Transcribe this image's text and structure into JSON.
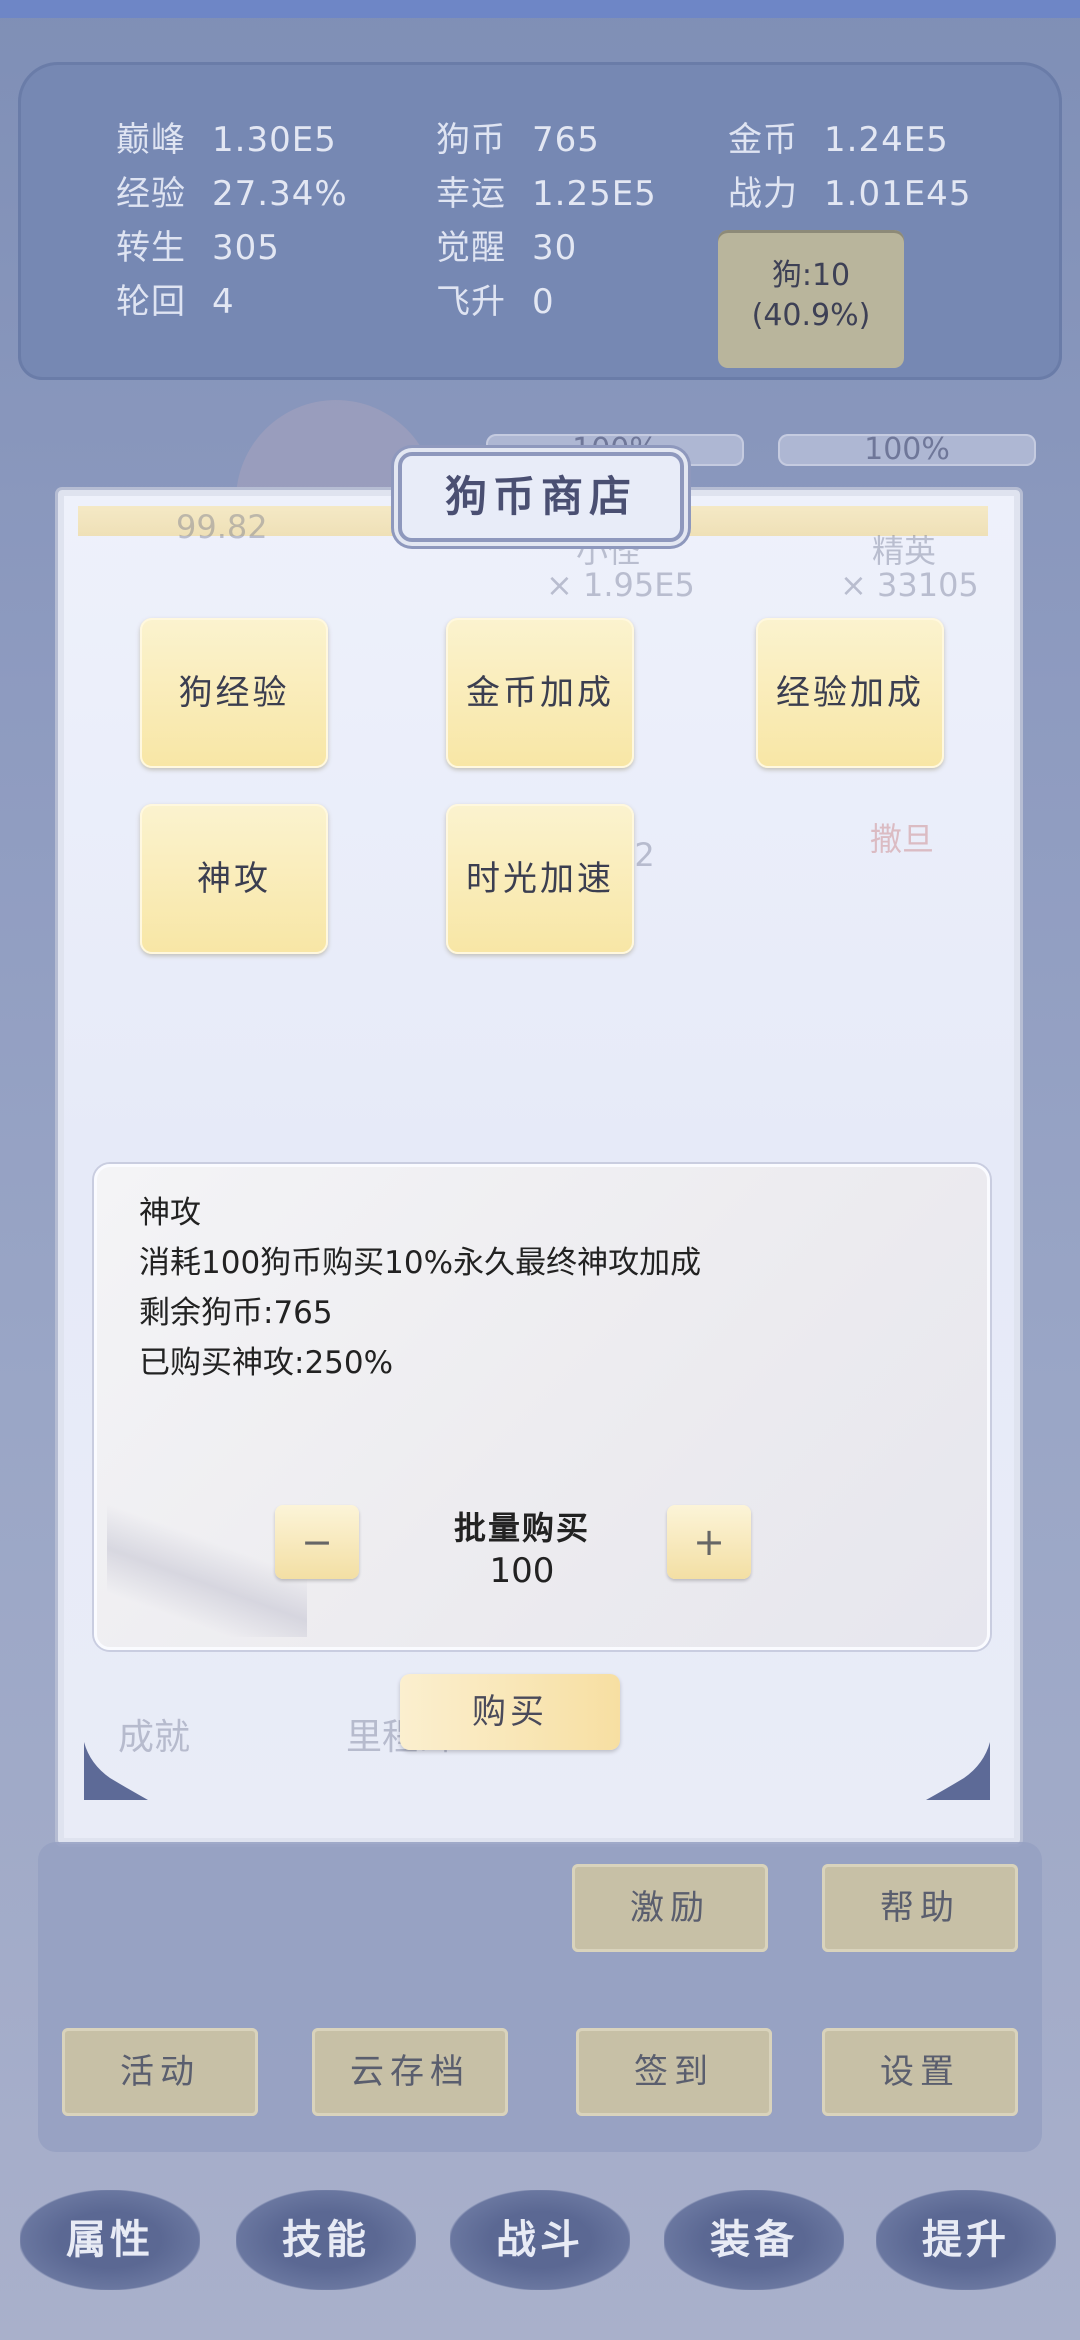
{
  "stats": {
    "peak": {
      "label": "巅峰",
      "value": "1.30E5"
    },
    "dog_coin": {
      "label": "狗币",
      "value": "765"
    },
    "gold": {
      "label": "金币",
      "value": "1.24E5"
    },
    "exp": {
      "label": "经验",
      "value": "27.34%"
    },
    "luck": {
      "label": "幸运",
      "value": "1.25E5"
    },
    "power": {
      "label": "战力",
      "value": "1.01E45"
    },
    "rebirth": {
      "label": "转生",
      "value": "305"
    },
    "awaken": {
      "label": "觉醒",
      "value": "30"
    },
    "reincarnation": {
      "label": "轮回",
      "value": "4"
    },
    "ascend": {
      "label": "飞升",
      "value": "0"
    },
    "dog_button": {
      "line1": "狗:10",
      "line2": "(40.9%)"
    }
  },
  "background": {
    "bar1": "100%",
    "bar2": "100%",
    "value_left": "99.82",
    "monster_name": "小怪",
    "monster_count": "× 1.95E5",
    "elite_name": "精英",
    "elite_count": "× 33105",
    "boss_name": "撒旦",
    "ghost_num": "42",
    "achievement": "成就",
    "milestone": "里程碑"
  },
  "shop": {
    "title": "狗币商店",
    "items": [
      "狗经验",
      "金币加成",
      "经验加成",
      "神攻",
      "时光加速"
    ],
    "detail": {
      "name": "神攻",
      "line1": "消耗100狗币购买10%永久最终神攻加成",
      "line2": "剩余狗币:765",
      "line3": "已购买神攻:250%"
    },
    "batch_label": "批量购买",
    "batch_value": "100",
    "minus": "−",
    "plus": "+",
    "buy_label": "购买"
  },
  "menu": {
    "incentive": "激励",
    "help": "帮助",
    "activity": "活动",
    "cloud_save": "云存档",
    "checkin": "签到",
    "settings": "设置"
  },
  "tabs": [
    "属性",
    "技能",
    "战斗",
    "装备",
    "提升"
  ],
  "colors": {
    "panel": "#7688b3",
    "button_yellow": "#f8e6a5",
    "background": "#8e9bc0"
  }
}
